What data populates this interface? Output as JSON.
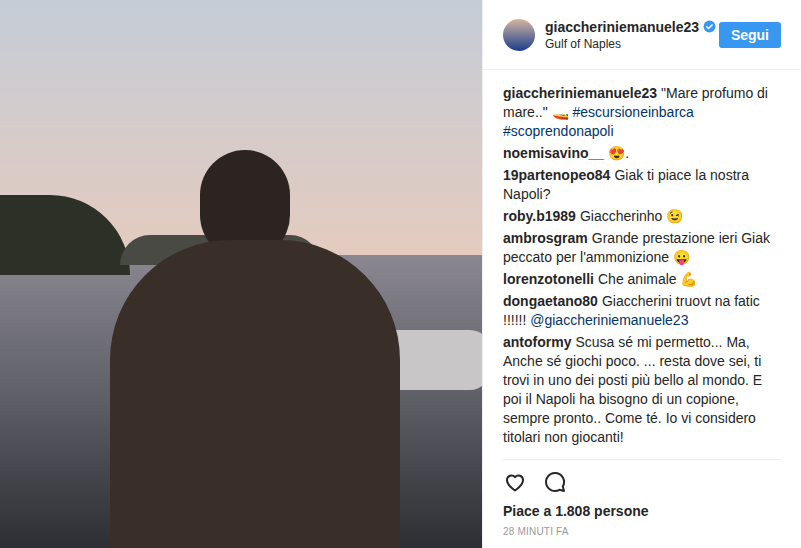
{
  "header": {
    "username": "giaccheriniemanuele23",
    "verified": true,
    "location": "Gulf of Naples",
    "follow_button": "Segui"
  },
  "comments": [
    {
      "user": "giaccheriniemanuele23",
      "segments": [
        {
          "text": "\"Mare profumo di mare..\" 🚤 ",
          "link": false
        },
        {
          "text": "#escursioneinbarca ",
          "link": true
        },
        {
          "text": "#scoprendonapoli",
          "link": true
        }
      ]
    },
    {
      "user": "noemisavino__",
      "segments": [
        {
          "text": "😍.",
          "link": false
        }
      ]
    },
    {
      "user": "19partenopeo84",
      "segments": [
        {
          "text": "Giak ti piace la nostra Napoli?",
          "link": false
        }
      ]
    },
    {
      "user": "roby.b1989",
      "segments": [
        {
          "text": "Giaccherinho 😉",
          "link": false
        }
      ]
    },
    {
      "user": "ambrosgram",
      "segments": [
        {
          "text": "Grande prestazione ieri Giak peccato per l'ammonizione 😛",
          "link": false
        }
      ]
    },
    {
      "user": "lorenzotonelli",
      "segments": [
        {
          "text": "Che animale 💪",
          "link": false
        }
      ]
    },
    {
      "user": "dongaetano80",
      "segments": [
        {
          "text": "Giaccherini truovt na fatic !!!!!! ",
          "link": false
        },
        {
          "text": "@giaccheriniemanuele23",
          "link": true
        }
      ]
    },
    {
      "user": "antoformy",
      "segments": [
        {
          "text": "Scusa sé mi permetto... Ma, Anche sé giochi poco. ... resta dove sei, ti trovi in uno dei posti più bello al mondo. E poi il Napoli ha bisogno di un copione, sempre pronto.. Come té. Io vi considero titolari non giocanti!",
          "link": false
        }
      ]
    }
  ],
  "actions": {
    "liked": false
  },
  "likes": "Piace a 1.808 persone",
  "time": "28 MINUTI FA"
}
